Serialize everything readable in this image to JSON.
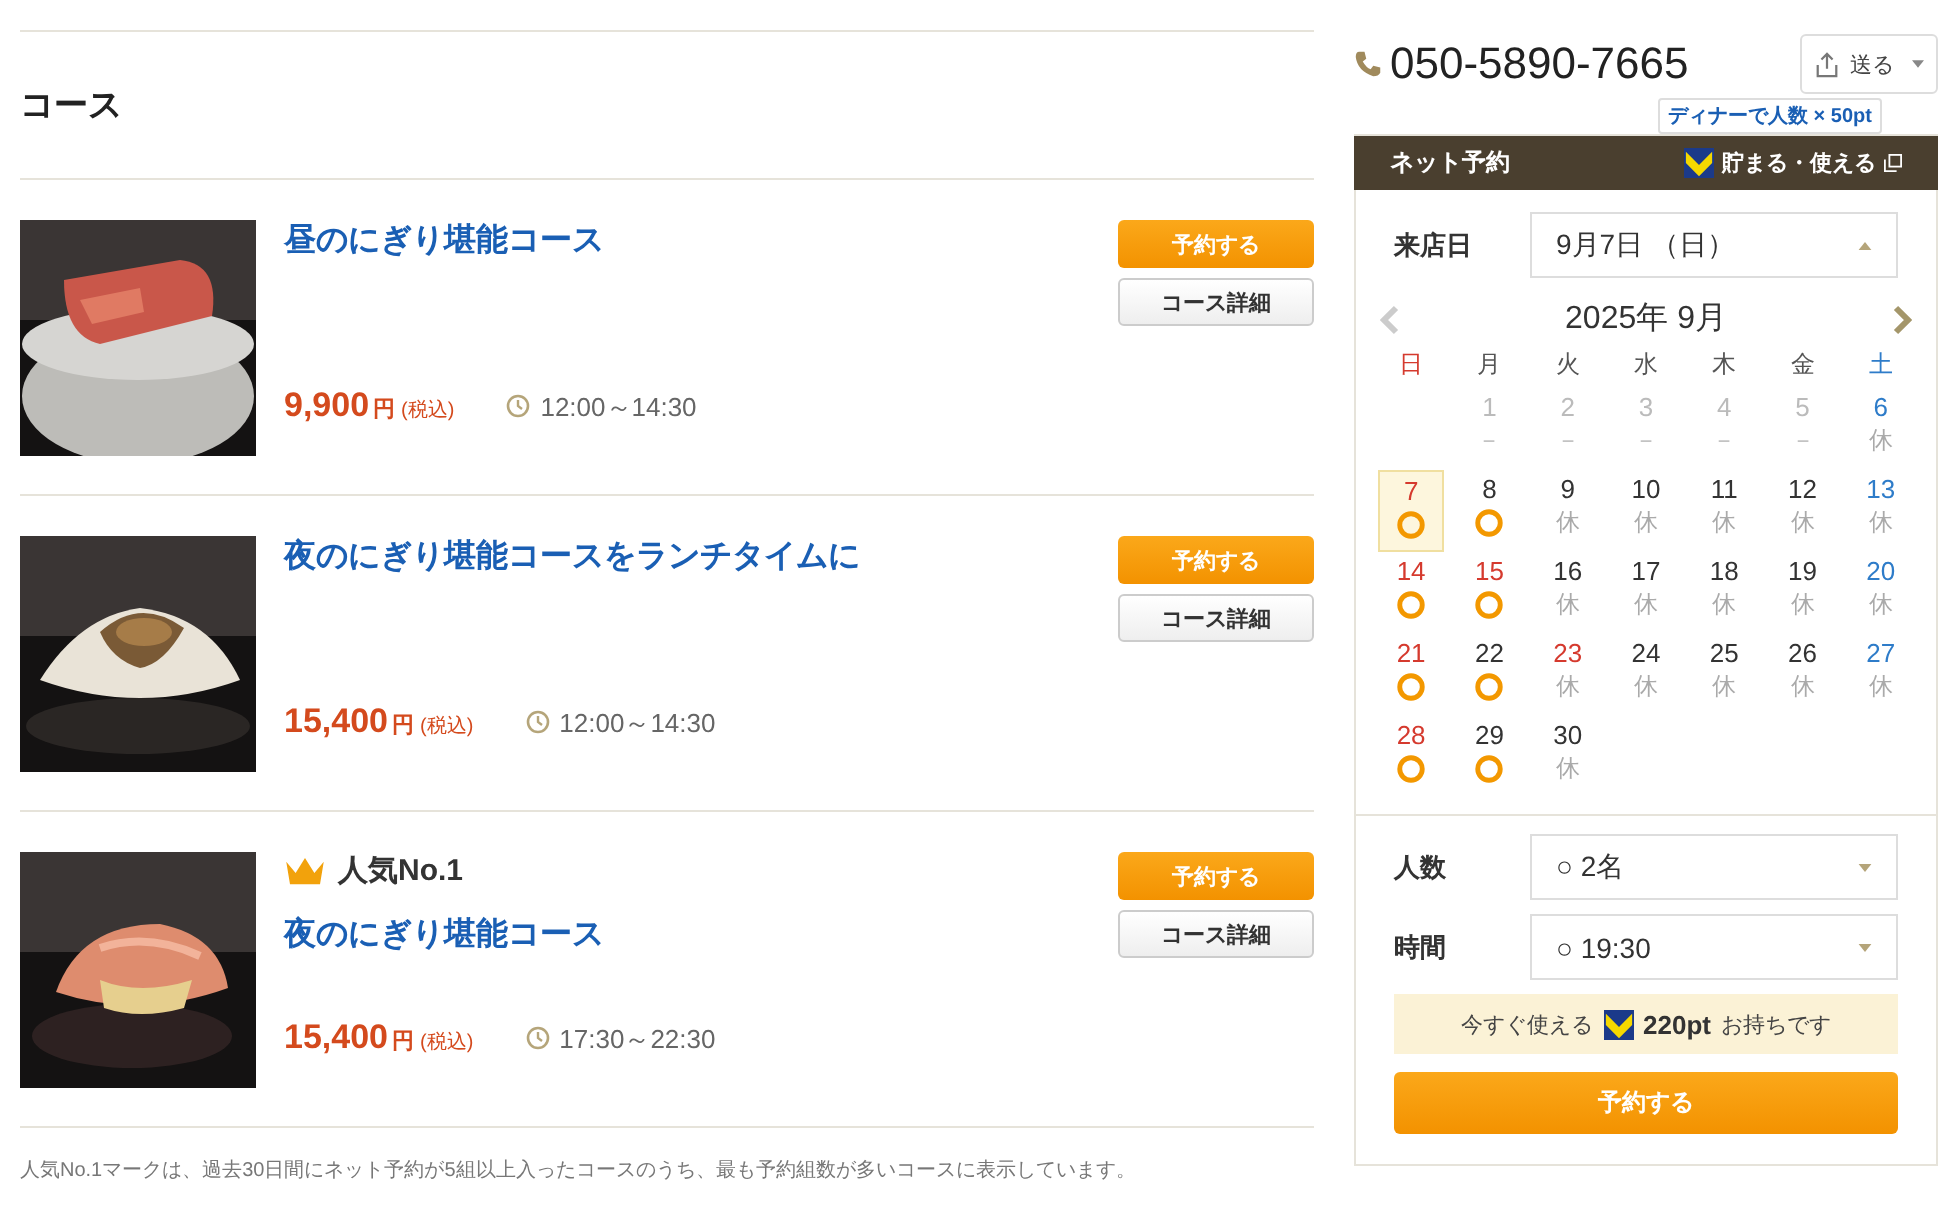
{
  "section_title": "コース",
  "courses": [
    {
      "name": "昼のにぎり堪能コース",
      "price": "9,900",
      "currency": "円",
      "tax": "(税込)",
      "hours": "12:00～14:30",
      "reserve_button": "予約する",
      "detail_button": "コース詳細"
    },
    {
      "name": "夜のにぎり堪能コースをランチタイムに",
      "price": "15,400",
      "currency": "円",
      "tax": "(税込)",
      "hours": "12:00～14:30",
      "reserve_button": "予約する",
      "detail_button": "コース詳細"
    },
    {
      "badge": "人気No.1",
      "name": "夜のにぎり堪能コース",
      "price": "15,400",
      "currency": "円",
      "tax": "(税込)",
      "hours": "17:30～22:30",
      "reserve_button": "予約する",
      "detail_button": "コース詳細"
    }
  ],
  "footnote": "人気No.1マークは、過去30日間にネット予約が5組以上入ったコースのうち、最も予約組数が多いコースに表示しています。",
  "phone": "050-5890-7665",
  "share_button": "送る",
  "reservation": {
    "title": "ネット予約",
    "tooltip": "ディナーで人数 × 50pt",
    "points_link": "貯まる・使える",
    "date_label": "来店日",
    "date_value": "9月7日 （日）",
    "month": "2025年 9月",
    "weekdays": [
      {
        "label": "日",
        "color": "#d53a2e"
      },
      {
        "label": "月",
        "color": "#555555"
      },
      {
        "label": "火",
        "color": "#555555"
      },
      {
        "label": "水",
        "color": "#555555"
      },
      {
        "label": "木",
        "color": "#555555"
      },
      {
        "label": "金",
        "color": "#555555"
      },
      {
        "label": "土",
        "color": "#2e7cc9"
      }
    ],
    "days": [
      {
        "kind": "blank"
      },
      {
        "label": "1",
        "kind": "none",
        "mark": "－",
        "color": "#bbbbbb",
        "selected": false
      },
      {
        "label": "2",
        "kind": "none",
        "mark": "－",
        "color": "#bbbbbb",
        "selected": false
      },
      {
        "label": "3",
        "kind": "none",
        "mark": "－",
        "color": "#bbbbbb",
        "selected": false
      },
      {
        "label": "4",
        "kind": "none",
        "mark": "－",
        "color": "#bbbbbb",
        "selected": false
      },
      {
        "label": "5",
        "kind": "none",
        "mark": "－",
        "color": "#bbbbbb",
        "selected": false
      },
      {
        "label": "6",
        "kind": "closed",
        "mark": "休",
        "color": "#2e7cc9",
        "selected": false
      },
      {
        "label": "7",
        "kind": "open",
        "color": "#d53a2e",
        "selected": true
      },
      {
        "label": "8",
        "kind": "open",
        "color": "#333333",
        "selected": false
      },
      {
        "label": "9",
        "kind": "closed",
        "mark": "休",
        "color": "#333333",
        "selected": false
      },
      {
        "label": "10",
        "kind": "closed",
        "mark": "休",
        "color": "#333333",
        "selected": false
      },
      {
        "label": "11",
        "kind": "closed",
        "mark": "休",
        "color": "#333333",
        "selected": false
      },
      {
        "label": "12",
        "kind": "closed",
        "mark": "休",
        "color": "#333333",
        "selected": false
      },
      {
        "label": "13",
        "kind": "closed",
        "mark": "休",
        "color": "#2e7cc9",
        "selected": false
      },
      {
        "label": "14",
        "kind": "open",
        "color": "#d53a2e",
        "selected": false
      },
      {
        "label": "15",
        "kind": "open",
        "color": "#d53a2e",
        "selected": false
      },
      {
        "label": "16",
        "kind": "closed",
        "mark": "休",
        "color": "#333333",
        "selected": false
      },
      {
        "label": "17",
        "kind": "closed",
        "mark": "休",
        "color": "#333333",
        "selected": false
      },
      {
        "label": "18",
        "kind": "closed",
        "mark": "休",
        "color": "#333333",
        "selected": false
      },
      {
        "label": "19",
        "kind": "closed",
        "mark": "休",
        "color": "#333333",
        "selected": false
      },
      {
        "label": "20",
        "kind": "closed",
        "mark": "休",
        "color": "#2e7cc9",
        "selected": false
      },
      {
        "label": "21",
        "kind": "open",
        "color": "#d53a2e",
        "selected": false
      },
      {
        "label": "22",
        "kind": "open",
        "color": "#333333",
        "selected": false
      },
      {
        "label": "23",
        "kind": "closed",
        "mark": "休",
        "color": "#d53a2e",
        "selected": false
      },
      {
        "label": "24",
        "kind": "closed",
        "mark": "休",
        "color": "#333333",
        "selected": false
      },
      {
        "label": "25",
        "kind": "closed",
        "mark": "休",
        "color": "#333333",
        "selected": false
      },
      {
        "label": "26",
        "kind": "closed",
        "mark": "休",
        "color": "#333333",
        "selected": false
      },
      {
        "label": "27",
        "kind": "closed",
        "mark": "休",
        "color": "#2e7cc9",
        "selected": false
      },
      {
        "label": "28",
        "kind": "open",
        "color": "#d53a2e",
        "selected": false
      },
      {
        "label": "29",
        "kind": "open",
        "color": "#333333",
        "selected": false
      },
      {
        "label": "30",
        "kind": "closed",
        "mark": "休",
        "color": "#333333",
        "selected": false
      }
    ],
    "fields": [
      {
        "label": "人数",
        "value": "○ 2名"
      },
      {
        "label": "時間",
        "value": "○ 19:30"
      }
    ],
    "points": {
      "prefix": "今すぐ使える",
      "amount": "220pt",
      "suffix": "お持ちです"
    },
    "submit_button": "予約する"
  }
}
